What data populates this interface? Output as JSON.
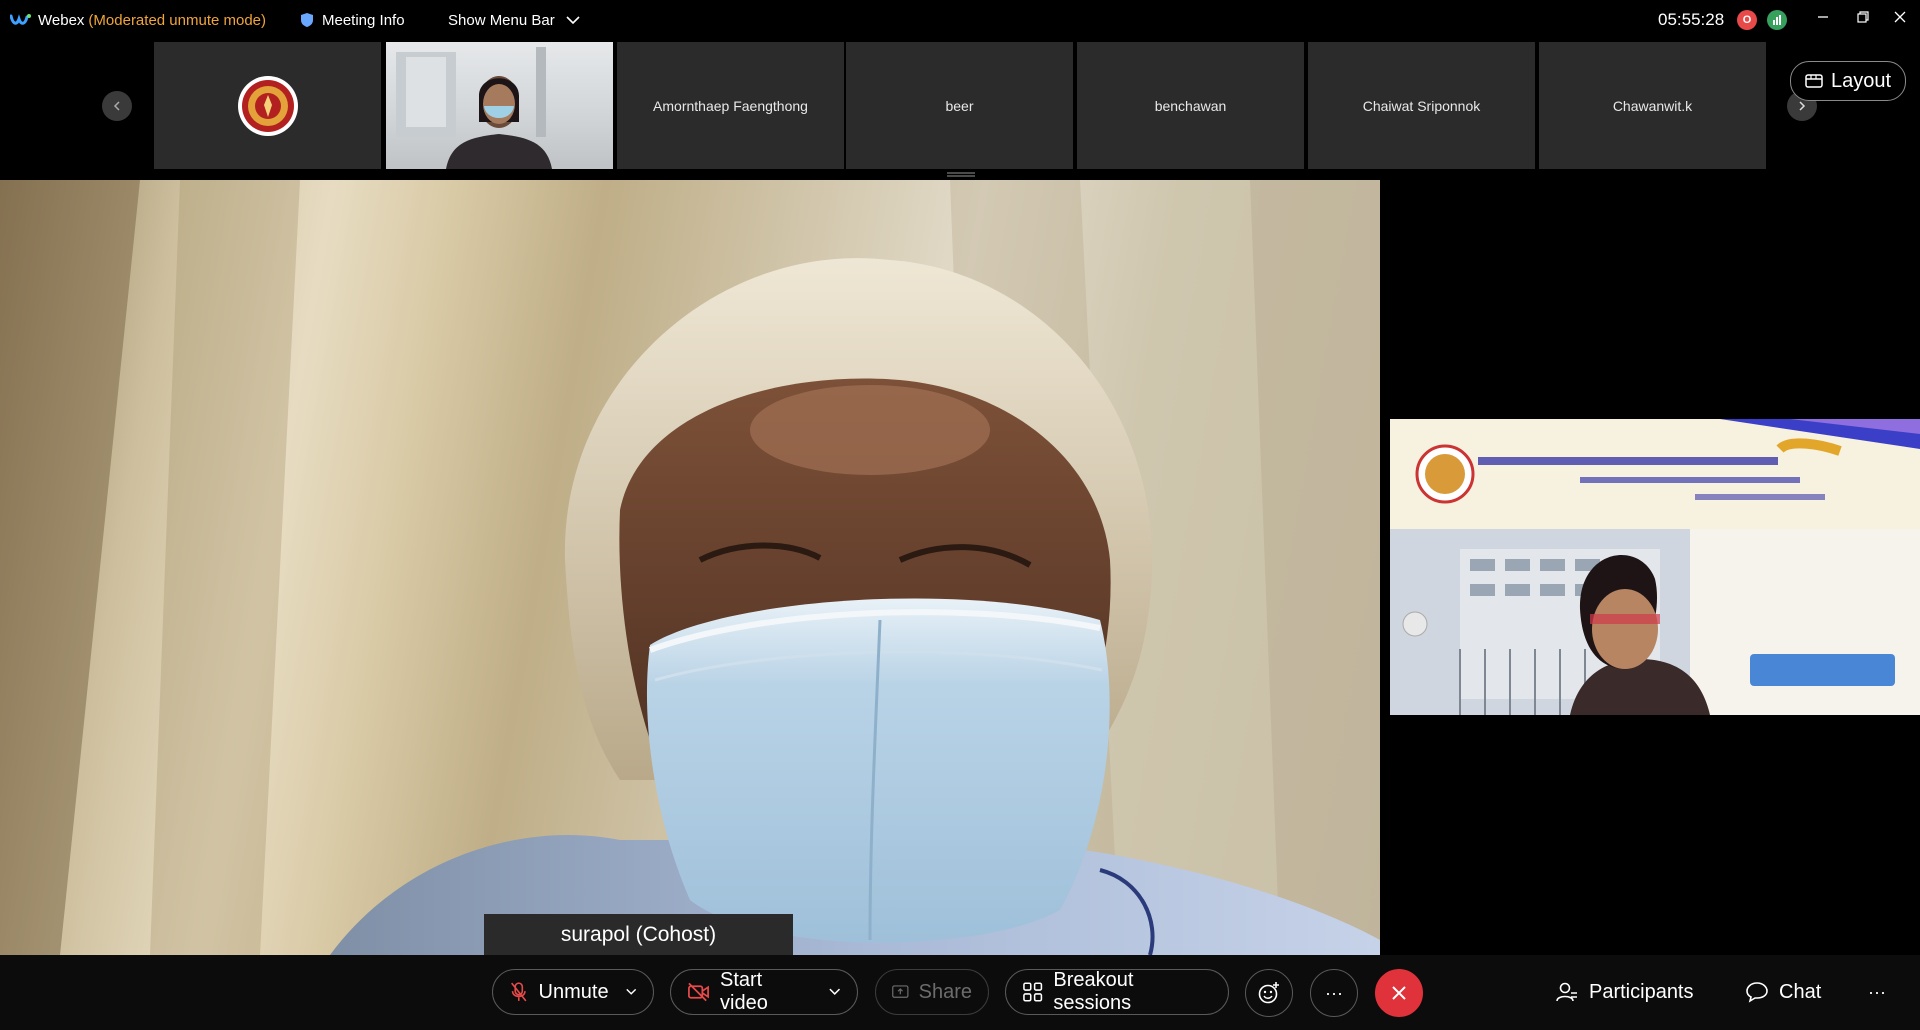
{
  "titlebar": {
    "app_name": "Webex",
    "mode": "(Moderated unmute mode)",
    "meeting_info": "Meeting Info",
    "show_menu_bar": "Show Menu Bar",
    "clock": "05:55:28",
    "recording_badge": "O"
  },
  "filmstrip": {
    "participants": [
      {
        "name": ""
      },
      {
        "name": ""
      },
      {
        "name": "Amornthaep Faengthong"
      },
      {
        "name": "beer"
      },
      {
        "name": "benchawan"
      },
      {
        "name": "Chaiwat Sriponnok"
      },
      {
        "name": "Chawanwit.k"
      }
    ],
    "layout_label": "Layout"
  },
  "stage": {
    "active_speaker": "surapol (Cohost)"
  },
  "controls": {
    "unmute": "Unmute",
    "start_video": "Start video",
    "share": "Share",
    "breakout": "Breakout sessions",
    "more": "···",
    "participants": "Participants",
    "chat": "Chat",
    "overflow": "···"
  },
  "colors": {
    "accent_mode": "#f0a43a",
    "end_call": "#e0323a",
    "recording": "#e84a4a",
    "stats": "#36a15d"
  },
  "icons": [
    "webex-logo-icon",
    "shield-icon",
    "chevron-down-icon",
    "record-icon",
    "stats-icon",
    "minimize-icon",
    "restore-icon",
    "close-icon",
    "chevron-left-icon",
    "chevron-right-icon",
    "layout-icon",
    "mic-muted-icon",
    "video-off-icon",
    "share-icon",
    "breakout-icon",
    "reaction-icon",
    "end-call-icon",
    "participants-icon",
    "chat-icon"
  ]
}
